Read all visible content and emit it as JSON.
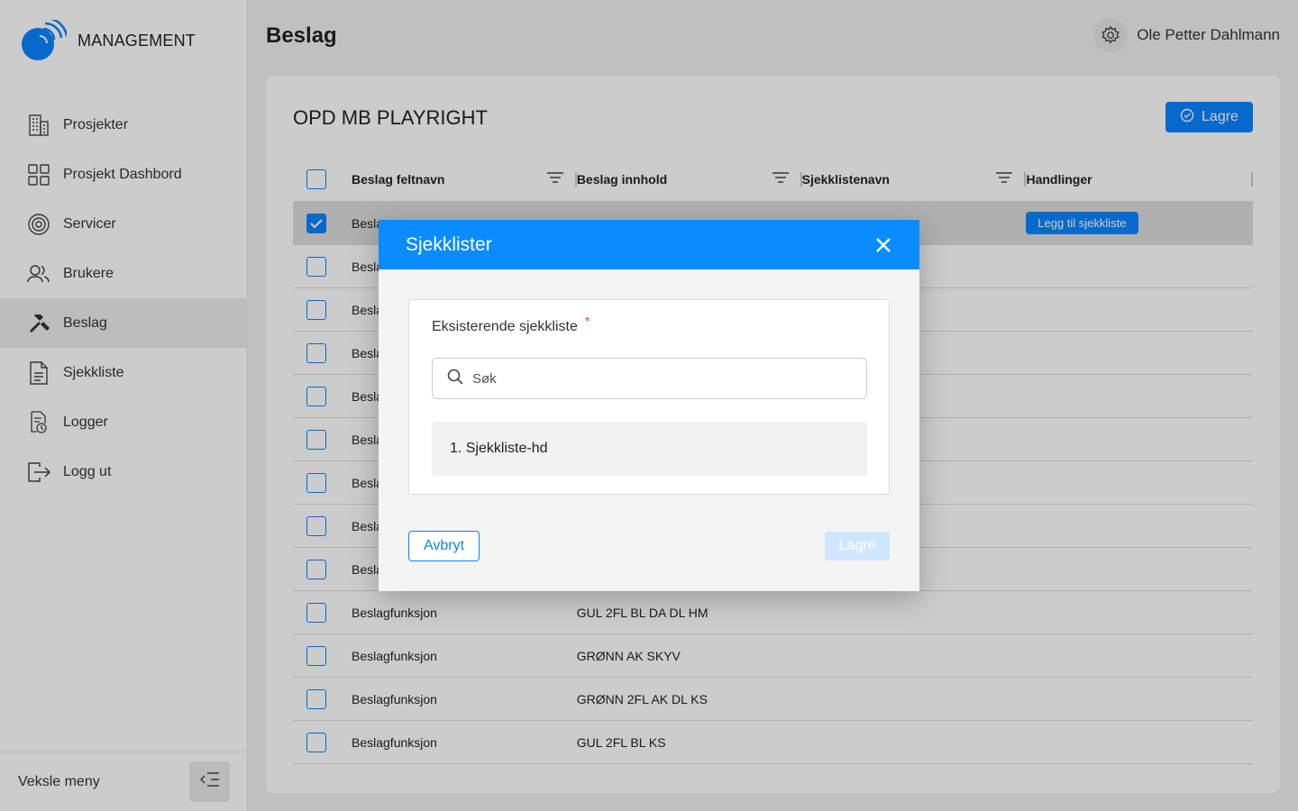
{
  "app": {
    "name": "MANAGEMENT"
  },
  "sidebar": {
    "items": [
      {
        "label": "Prosjekter",
        "icon": "building-icon"
      },
      {
        "label": "Prosjekt Dashbord",
        "icon": "grid-icon"
      },
      {
        "label": "Servicer",
        "icon": "settings-icon"
      },
      {
        "label": "Brukere",
        "icon": "users-icon"
      },
      {
        "label": "Beslag",
        "icon": "tools-icon"
      },
      {
        "label": "Sjekkliste",
        "icon": "document-icon"
      },
      {
        "label": "Logger",
        "icon": "log-icon"
      },
      {
        "label": "Logg ut",
        "icon": "logout-icon"
      }
    ],
    "active": "Beslag",
    "footer_label": "Veksle meny"
  },
  "header": {
    "title": "Beslag",
    "user_name": "Ole Petter Dahlmann"
  },
  "card": {
    "title": "OPD MB PLAYRIGHT",
    "save_label": "Lagre",
    "table": {
      "columns": [
        "Beslag feltnavn",
        "Beslag innhold",
        "Sjekklistenavn",
        "Handlinger"
      ],
      "row_action_label": "Legg til sjekkliste",
      "rows": [
        {
          "name": "Besla",
          "content": "",
          "checklist": "",
          "checked": true
        },
        {
          "name": "Besla",
          "content": "",
          "checklist": "",
          "checked": false
        },
        {
          "name": "Besla",
          "content": "",
          "checklist": "",
          "checked": false
        },
        {
          "name": "Besla",
          "content": "",
          "checklist": "",
          "checked": false
        },
        {
          "name": "Besla",
          "content": "",
          "checklist": "",
          "checked": false
        },
        {
          "name": "Besla",
          "content": "",
          "checklist": "",
          "checked": false
        },
        {
          "name": "Besla",
          "content": "",
          "checklist": "",
          "checked": false
        },
        {
          "name": "Besla",
          "content": "",
          "checklist": "",
          "checked": false
        },
        {
          "name": "Besla",
          "content": "",
          "checklist": "",
          "checked": false
        },
        {
          "name": "Beslagfunksjon",
          "content": "GUL 2FL BL DA DL HM",
          "checklist": "",
          "checked": false
        },
        {
          "name": "Beslagfunksjon",
          "content": "GRØNN AK SKYV",
          "checklist": "",
          "checked": false
        },
        {
          "name": "Beslagfunksjon",
          "content": "GRØNN 2FL AK DL KS",
          "checklist": "",
          "checked": false
        },
        {
          "name": "Beslagfunksjon",
          "content": "GUL 2FL BL KS",
          "checklist": "",
          "checked": false
        }
      ]
    }
  },
  "modal": {
    "title": "Sjekklister",
    "field_label": "Eksisterende sjekkliste",
    "required_mark": "*",
    "search_placeholder": "Søk",
    "options": [
      {
        "number": "1.",
        "label": "Sjekkliste-hd"
      }
    ],
    "cancel_label": "Avbryt",
    "save_label": "Lagre"
  },
  "colors": {
    "primary": "#0a84ff",
    "modal_header": "#0a8cff",
    "disabled": "#cfe6ff"
  }
}
